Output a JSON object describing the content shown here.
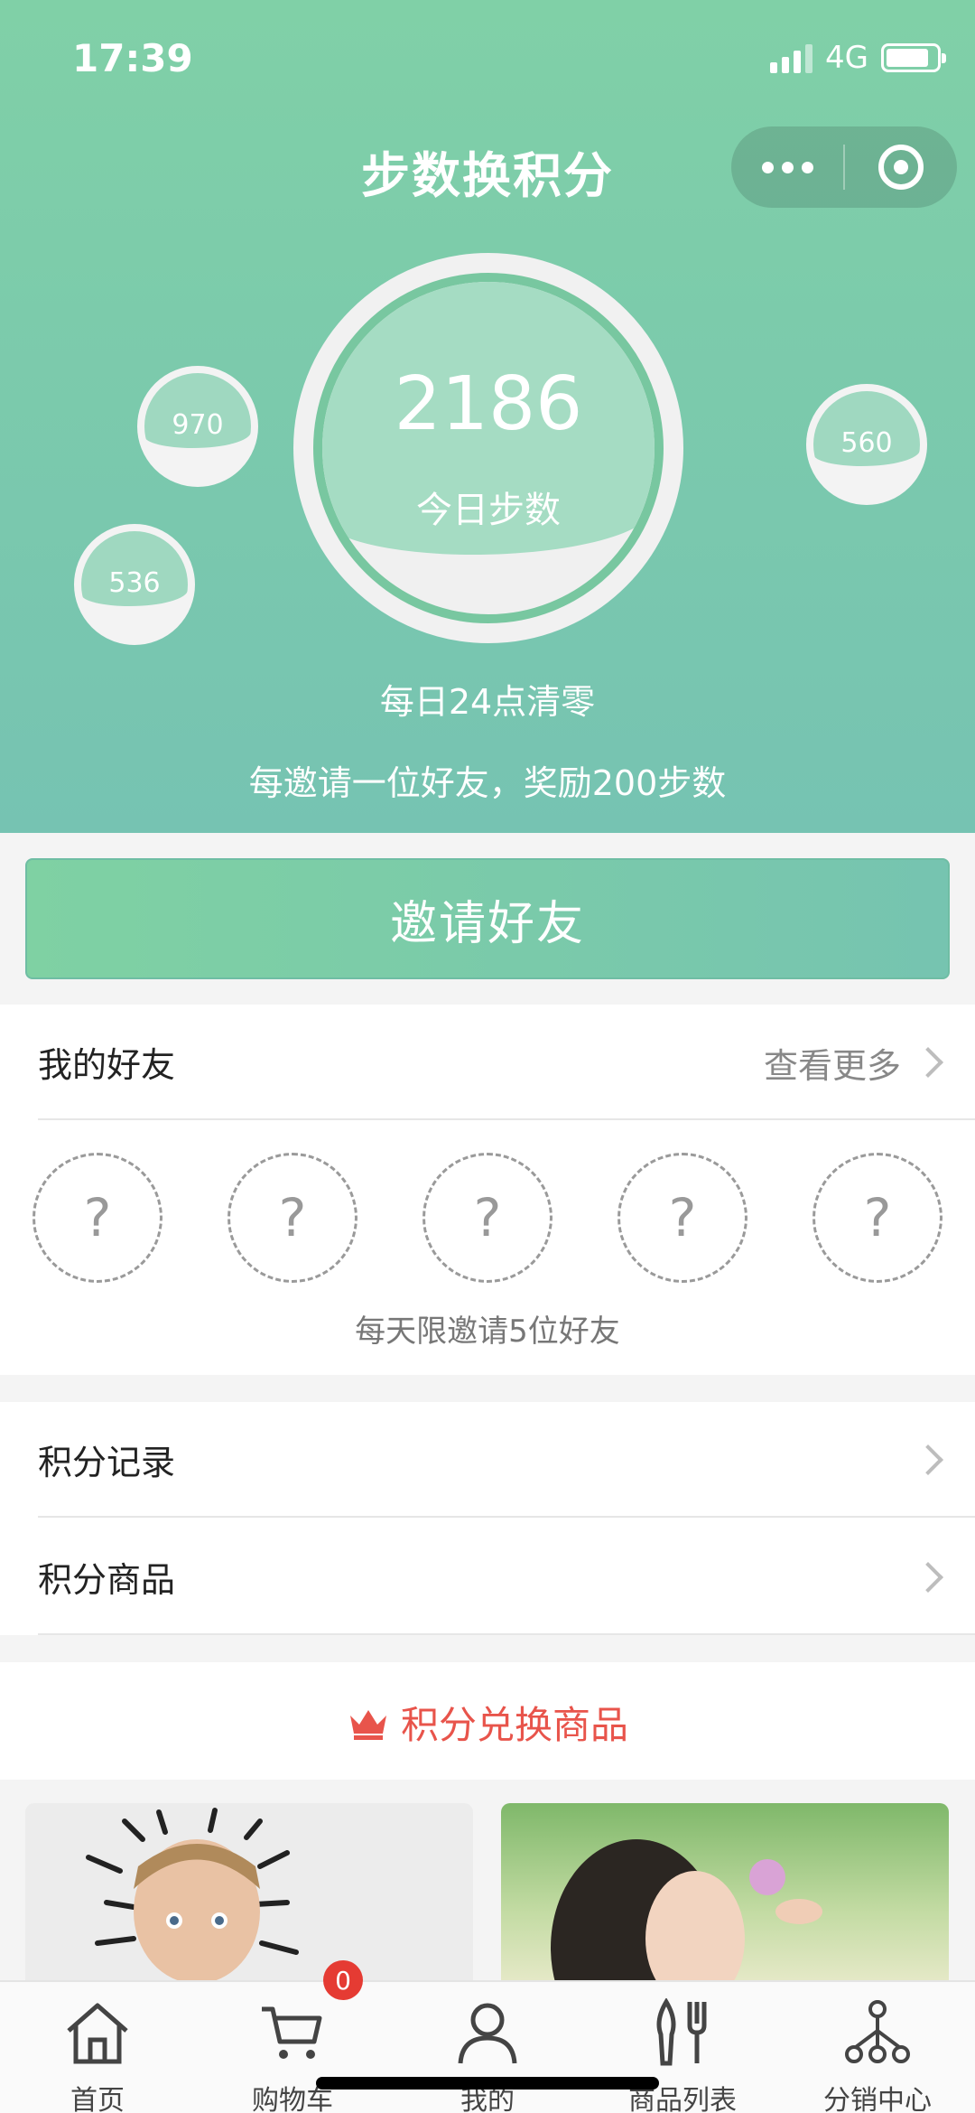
{
  "status_bar": {
    "time": "17:39",
    "network": "4G"
  },
  "nav": {
    "title": "步数换积分"
  },
  "steps": {
    "value": "2186",
    "label": "今日步数"
  },
  "bubbles": [
    "970",
    "536",
    "560"
  ],
  "hints": {
    "reset": "每日24点清零",
    "reward": "每邀请一位好友，奖励200步数"
  },
  "invite_button": "邀请好友",
  "friends": {
    "title": "我的好友",
    "more": "查看更多",
    "slots": [
      "?",
      "?",
      "?",
      "?",
      "?"
    ],
    "limit": "每天限邀请5位好友"
  },
  "menu": {
    "points_record": "积分记录",
    "points_goods": "积分商品"
  },
  "exchange": {
    "title": "积分兑换商品"
  },
  "tabbar": {
    "items": [
      {
        "label": "首页",
        "icon": "home-icon"
      },
      {
        "label": "购物车",
        "icon": "cart-icon"
      },
      {
        "label": "我的",
        "icon": "user-icon"
      },
      {
        "label": "商品列表",
        "icon": "cutlery-icon"
      },
      {
        "label": "分销中心",
        "icon": "network-icon"
      }
    ],
    "cart_badge": "0"
  },
  "colors": {
    "theme_green": "#80d0a7",
    "accent_red": "#e8544b",
    "badge_red": "#e53b33"
  }
}
